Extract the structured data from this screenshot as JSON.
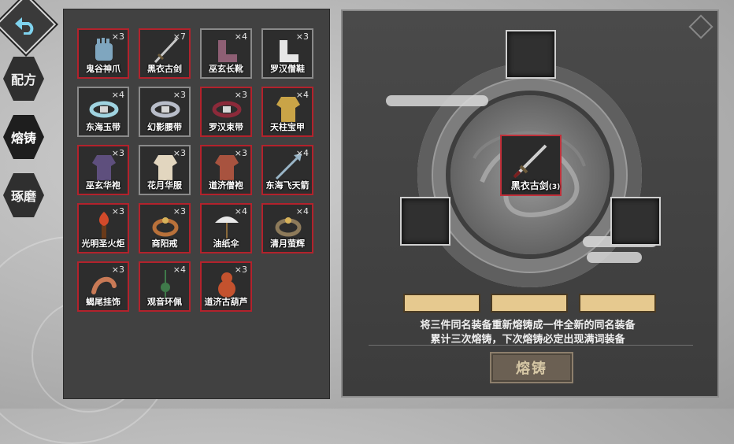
{
  "nav": {
    "tabs": [
      {
        "label": "配方"
      },
      {
        "label": "熔铸"
      },
      {
        "label": "琢磨"
      }
    ]
  },
  "inventory": {
    "items": [
      {
        "name": "鬼谷神爪",
        "count": "×3",
        "icon": "gauntlet-icon",
        "color": "#7fa6bf"
      },
      {
        "name": "黑衣古剑",
        "count": "×7",
        "icon": "sword-icon",
        "color": "#c7c7c7"
      },
      {
        "name": "巫玄长靴",
        "count": "×4",
        "icon": "boots-icon",
        "color": "#8e5f74"
      },
      {
        "name": "罗汉僧鞋",
        "count": "×3",
        "icon": "shoes-icon",
        "color": "#e6e6e6"
      },
      {
        "name": "东海玉带",
        "count": "×4",
        "icon": "belt-icon",
        "color": "#9fd3e0"
      },
      {
        "name": "幻影腰带",
        "count": "×3",
        "icon": "belt-icon",
        "color": "#b8bdc9"
      },
      {
        "name": "罗汉束带",
        "count": "×3",
        "icon": "bead-belt-icon",
        "color": "#8c2a3a"
      },
      {
        "name": "天柱宝甲",
        "count": "×4",
        "icon": "armor-icon",
        "color": "#c9a447"
      },
      {
        "name": "巫玄华袍",
        "count": "×3",
        "icon": "robe-icon",
        "color": "#5e4f7d"
      },
      {
        "name": "花月华服",
        "count": "×3",
        "icon": "robe-icon",
        "color": "#e2d6bf"
      },
      {
        "name": "道济僧袍",
        "count": "×3",
        "icon": "robe-icon",
        "color": "#a8533f"
      },
      {
        "name": "东海飞天箭",
        "count": "×4",
        "icon": "arrow-icon",
        "color": "#9ab6c8"
      },
      {
        "name": "光明圣火炬",
        "count": "×3",
        "icon": "torch-icon",
        "color": "#d24a2a"
      },
      {
        "name": "商阳戒",
        "count": "×3",
        "icon": "ring-icon",
        "color": "#b9713a"
      },
      {
        "name": "油纸伞",
        "count": "×4",
        "icon": "umbrella-icon",
        "color": "#e8e8e8"
      },
      {
        "name": "清月萤辉",
        "count": "×4",
        "icon": "ring-icon",
        "color": "#8d7a5a"
      },
      {
        "name": "蝎尾挂饰",
        "count": "×3",
        "icon": "scorpion-tail-icon",
        "color": "#c97a56"
      },
      {
        "name": "观音环佩",
        "count": "×4",
        "icon": "pendant-icon",
        "color": "#3f7a4a"
      },
      {
        "name": "道济古葫芦",
        "count": "×3",
        "icon": "gourd-icon",
        "color": "#c4522e"
      }
    ]
  },
  "forge": {
    "center_item": {
      "name": "黑衣古剑",
      "level": "(3)"
    },
    "desc_line1": "将三件同名装备重新熔铸成一件全新的同名装备",
    "desc_line2": "累计三次熔铸，下次熔铸必定出现满词装备",
    "button_label": "熔铸"
  }
}
